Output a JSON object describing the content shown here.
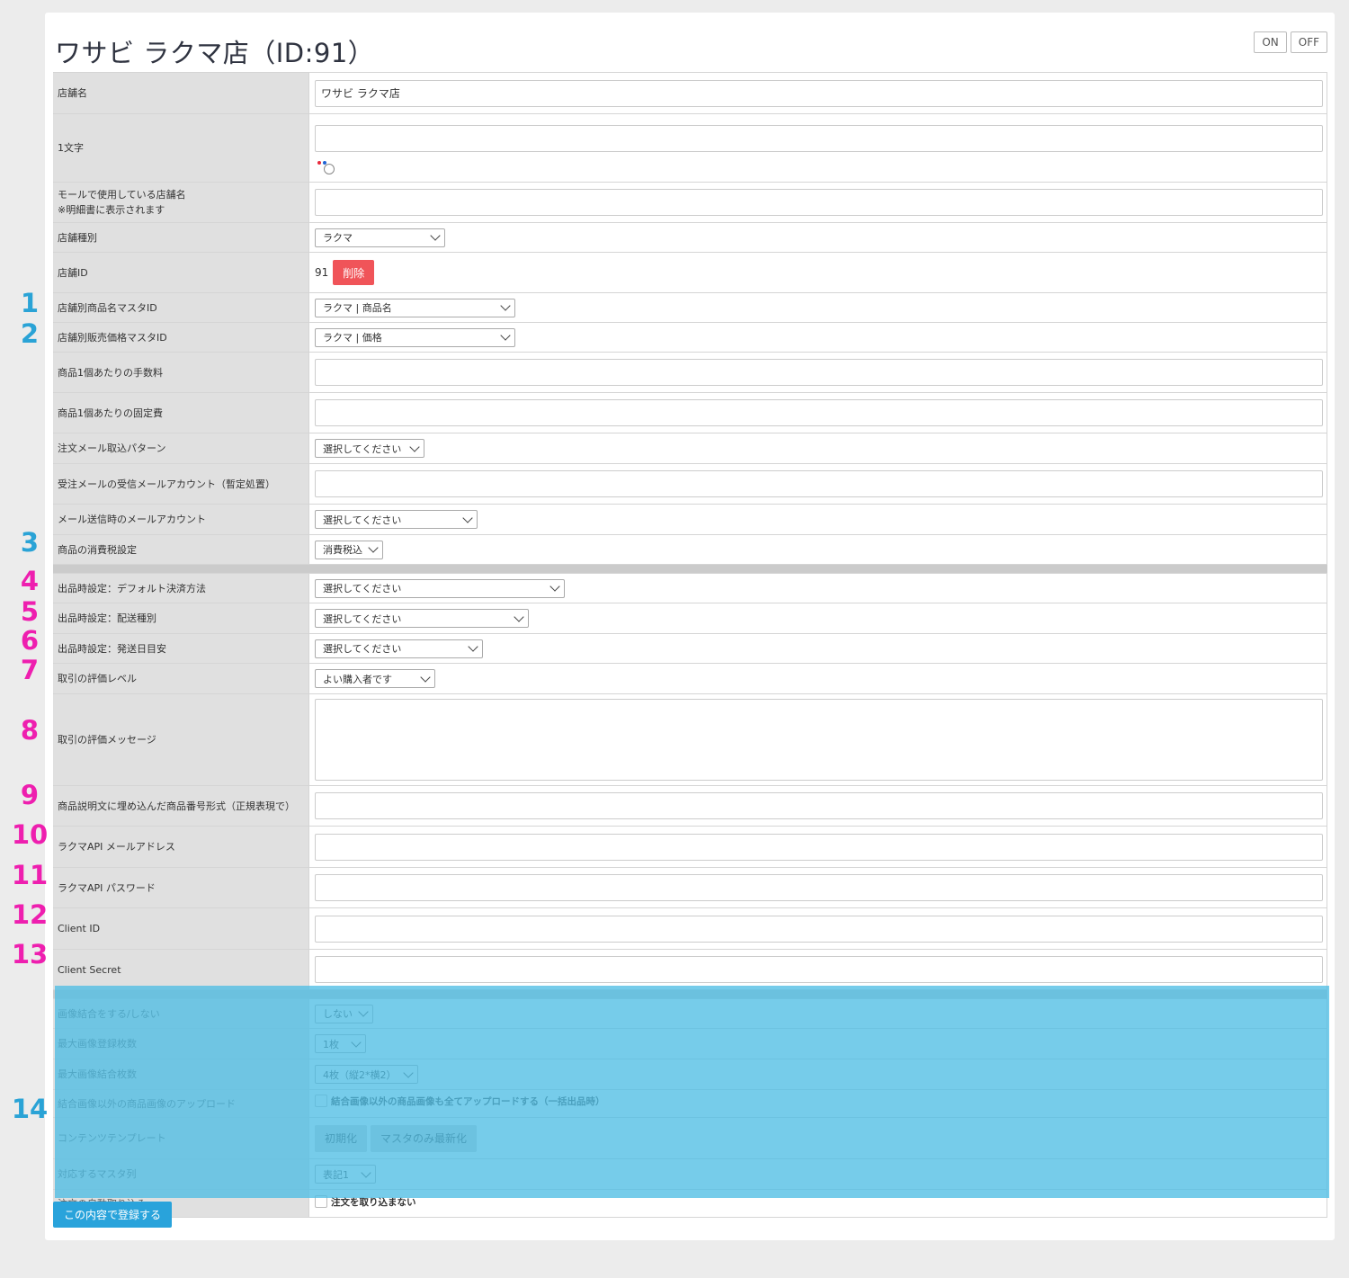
{
  "page": {
    "title": "ワサビ ラクマ店（ID:91）",
    "on_label": "ON",
    "off_label": "OFF",
    "submit_label": "この内容で登録する"
  },
  "fields": {
    "shop_name": {
      "label": "店舗名",
      "value": "ワサビ ラクマ店"
    },
    "one_char": {
      "label": "1文字",
      "value": "",
      "color_dots": [
        "#e8293b",
        "#1f62d4"
      ]
    },
    "mall_shop_name": {
      "label": "モールで使用している店舗名\n※明細書に表示されます",
      "value": ""
    },
    "shop_type": {
      "label": "店舗種別",
      "value": "ラクマ"
    },
    "shop_id": {
      "label": "店舗ID",
      "value": "91",
      "delete_label": "削除"
    },
    "product_name_master": {
      "label": "店舗別商品名マスタID",
      "value": "ラクマ | 商品名"
    },
    "price_master": {
      "label": "店舗別販売価格マスタID",
      "value": "ラクマ | 価格"
    },
    "fee_per_item": {
      "label": "商品1個あたりの手数料",
      "value": ""
    },
    "fixed_cost_per_item": {
      "label": "商品1個あたりの固定費",
      "value": ""
    },
    "order_mail_pattern": {
      "label": "注文メール取込パターン",
      "value": "選択してください"
    },
    "receiving_mail_account": {
      "label": "受注メールの受信メールアカウント（暫定処置）",
      "value": ""
    },
    "sending_mail_account": {
      "label": "メール送信時のメールアカウント",
      "value": "選択してください"
    },
    "tax_setting": {
      "label": "商品の消費税設定",
      "value": "消費税込"
    },
    "default_payment": {
      "label": "出品時設定：デフォルト決済方法",
      "value": "選択してください"
    },
    "shipping_type": {
      "label": "出品時設定：配送種別",
      "value": "選択してください"
    },
    "ship_days": {
      "label": "出品時設定：発送日目安",
      "value": "選択してください"
    },
    "rating_level": {
      "label": "取引の評価レベル",
      "value": "よい購入者です"
    },
    "rating_message": {
      "label": "取引の評価メッセージ",
      "value": ""
    },
    "item_number_regex": {
      "label": "商品説明文に埋め込んだ商品番号形式（正規表現で）",
      "value": ""
    },
    "api_email": {
      "label": "ラクマAPI メールアドレス",
      "value": ""
    },
    "api_password": {
      "label": "ラクマAPI パスワード",
      "value": ""
    },
    "client_id": {
      "label": "Client ID",
      "value": ""
    },
    "client_secret": {
      "label": "Client Secret",
      "value": ""
    },
    "image_merge": {
      "label": "画像結合をする/しない",
      "value": "しない"
    },
    "max_images": {
      "label": "最大画像登録枚数",
      "value": "1枚"
    },
    "max_merge": {
      "label": "最大画像結合枚数",
      "value": "4枚（縦2*横2）"
    },
    "upload_other": {
      "label": "結合画像以外の商品画像のアップロード",
      "checkbox_label": "結合画像以外の商品画像も全てアップロードする（一括出品時）"
    },
    "content_template": {
      "label": "コンテンツテンプレート",
      "init_label": "初期化",
      "refresh_label": "マスタのみ最新化"
    },
    "master_column": {
      "label": "対応するマスタ列",
      "value": "表記1"
    },
    "auto_import": {
      "label": "注文の自動取り込み",
      "checkbox_label": "注文を取り込まない"
    }
  },
  "annotations": {
    "n1": "1",
    "n2": "2",
    "n3": "3",
    "n4": "4",
    "n5": "5",
    "n6": "6",
    "n7": "7",
    "n8": "8",
    "n9": "9",
    "n10": "10",
    "n11": "11",
    "n12": "12",
    "n13": "13",
    "n14": "14",
    "blue_color": "#2aa3d6",
    "pink_color": "#ee1faf"
  }
}
